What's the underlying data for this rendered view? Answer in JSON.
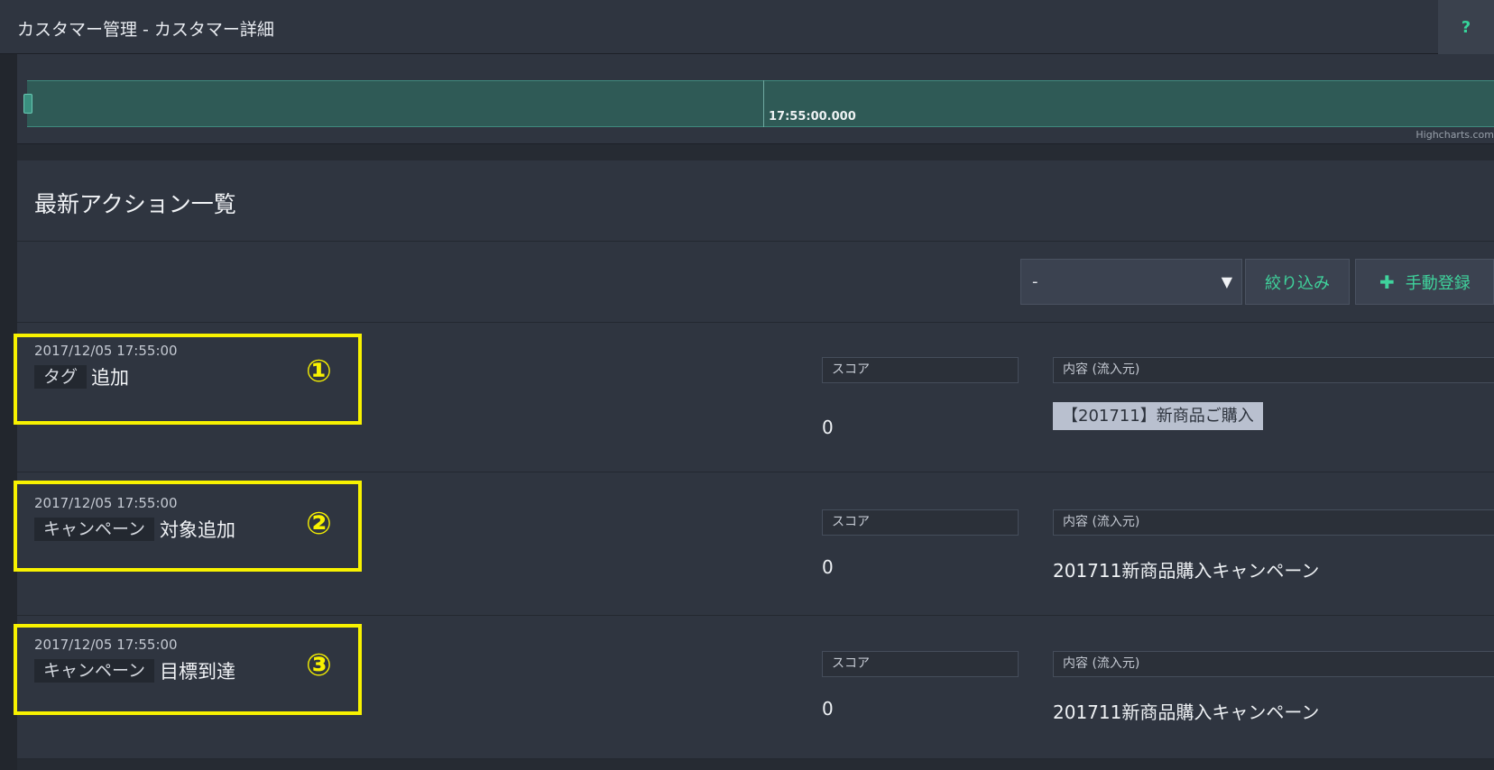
{
  "header": {
    "title": "カスタマー管理 - カスタマー詳細",
    "help_label": "?"
  },
  "timeline": {
    "tick_label": "17:55:00.000",
    "credit": "Highcharts.com"
  },
  "actions_section": {
    "title": "最新アクション一覧",
    "filter_select": {
      "selected": "-"
    },
    "filter_button": "絞り込み",
    "add_button": {
      "icon": "plus-icon",
      "label": "手動登録"
    },
    "rows": [
      {
        "timestamp": "2017/12/05 17:55:00",
        "category": "タグ",
        "action": "追加",
        "marker": "①",
        "score_label": "スコア",
        "score": "0",
        "content_label": "内容 (流入元)",
        "content": "【201711】新商品ご購入"
      },
      {
        "timestamp": "2017/12/05 17:55:00",
        "category": "キャンペーン",
        "action": "対象追加",
        "marker": "②",
        "score_label": "スコア",
        "score": "0",
        "content_label": "内容 (流入元)",
        "content": "201711新商品購入キャンペーン"
      },
      {
        "timestamp": "2017/12/05 17:55:00",
        "category": "キャンペーン",
        "action": "目標到達",
        "marker": "③",
        "score_label": "スコア",
        "score": "0",
        "content_label": "内容 (流入元)",
        "content": "201711新商品購入キャンペーン"
      }
    ]
  },
  "colors": {
    "accent": "#3fd39c",
    "highlight": "#f8f200",
    "navigator": "#2f5a56"
  }
}
